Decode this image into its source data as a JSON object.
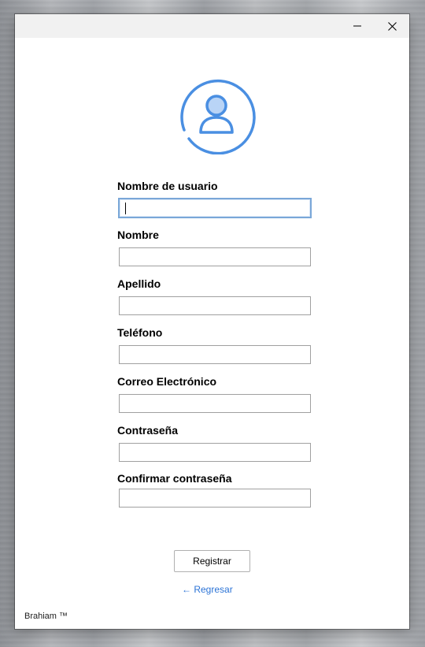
{
  "window": {
    "minimize_icon": "minimize-icon",
    "close_icon": "close-icon"
  },
  "avatar": {
    "icon": "user-avatar-icon",
    "accent_color": "#4a8fe2",
    "fill_color": "#b9d4f6"
  },
  "form": {
    "fields": [
      {
        "label": "Nombre de usuario",
        "value": "",
        "focused": true
      },
      {
        "label": "Nombre",
        "value": ""
      },
      {
        "label": "Apellido",
        "value": ""
      },
      {
        "label": "Teléfono",
        "value": ""
      },
      {
        "label": "Correo Electrónico",
        "value": ""
      },
      {
        "label": "Contraseña",
        "value": ""
      },
      {
        "label": "Confirmar contraseña",
        "value": ""
      }
    ],
    "register_label": "Registrar",
    "back_label": "← Regresar"
  },
  "footer": {
    "text": "Brahiam ™"
  },
  "colors": {
    "link": "#2b73d6",
    "focus_border": "#7aa7d8",
    "input_border": "#a0a0a0"
  }
}
